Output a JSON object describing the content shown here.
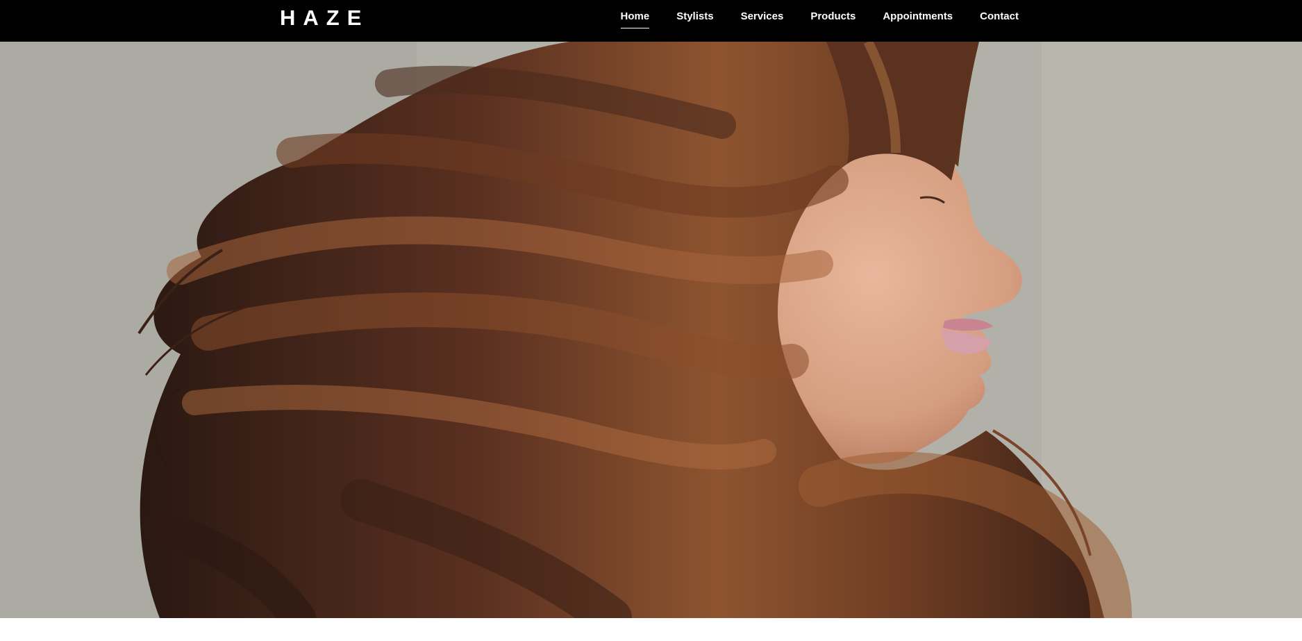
{
  "brand": {
    "name": "HAZE"
  },
  "nav": {
    "items": [
      {
        "label": "Home",
        "active": true
      },
      {
        "label": "Stylists",
        "active": false
      },
      {
        "label": "Services",
        "active": false
      },
      {
        "label": "Products",
        "active": false
      },
      {
        "label": "Appointments",
        "active": false
      },
      {
        "label": "Contact",
        "active": false
      }
    ]
  },
  "hero": {
    "image_icon": "hero-photo-woman-flowing-brown-hair"
  },
  "colors": {
    "header_bg": "#000000",
    "header_text": "#ffffff",
    "hero_backdrop": "#b3b2aa",
    "hair_dark": "#2b1812",
    "hair_light": "#9a5a33",
    "skin": "#d9a286"
  }
}
